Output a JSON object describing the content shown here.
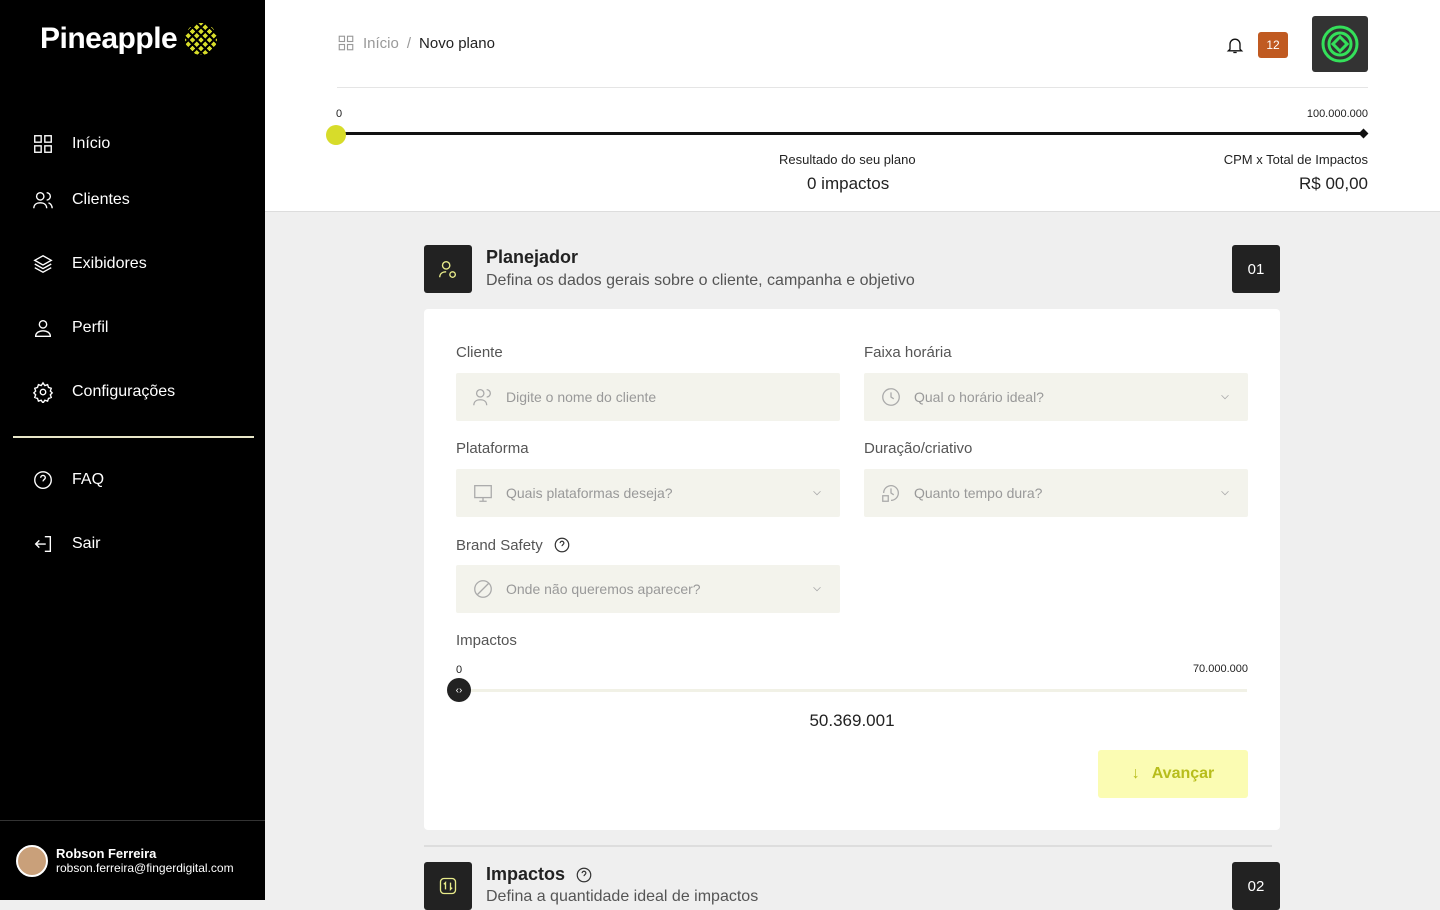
{
  "brand": {
    "name": "Pineapple"
  },
  "sidebar": {
    "items": [
      {
        "label": "Início",
        "icon": "grid-icon"
      },
      {
        "label": "Clientes",
        "icon": "users-icon"
      },
      {
        "label": "Exibidores",
        "icon": "layers-icon"
      },
      {
        "label": "Perfil",
        "icon": "user-icon"
      },
      {
        "label": "Configurações",
        "icon": "gear-icon"
      },
      {
        "label": "FAQ",
        "icon": "help-icon"
      },
      {
        "label": "Sair",
        "icon": "logout-icon"
      }
    ],
    "user": {
      "name": "Robson Ferreira",
      "email": "robson.ferreira@fingerdigital.com"
    }
  },
  "header": {
    "breadcrumb": [
      "Início",
      "Novo plano"
    ],
    "notifications": "12"
  },
  "plan_bar": {
    "min": "0",
    "max": "100.000.000",
    "value_fraction": 0,
    "result_label": "Resultado do seu plano",
    "result_value": "0 impactos",
    "cpm_label": "CPM x Total de Impactos",
    "cpm_value": "R$ 00,00"
  },
  "section1": {
    "title": "Planejador",
    "subtitle": "Defina os dados gerais sobre o cliente, campanha e objetivo",
    "number": "01",
    "fields": {
      "cliente": {
        "label": "Cliente",
        "placeholder": "Digite o nome do cliente"
      },
      "faixa": {
        "label": "Faixa horária",
        "placeholder": "Qual o horário ideal?"
      },
      "plataforma": {
        "label": "Plataforma",
        "placeholder": "Quais plataformas deseja?"
      },
      "duracao": {
        "label": "Duração/criativo",
        "placeholder": "Quanto tempo dura?"
      },
      "brand_safety": {
        "label": "Brand Safety",
        "placeholder": "Onde não queremos aparecer?"
      }
    },
    "impactos": {
      "label": "Impactos",
      "min": "0",
      "max": "70.000.000",
      "value": "50.369.001"
    },
    "next_button": "Avançar"
  },
  "section2": {
    "title": "Impactos",
    "subtitle": "Defina a quantidade ideal de impactos",
    "number": "02"
  },
  "colors": {
    "accent": "#d7dc2a",
    "badge": "#c05a21"
  }
}
